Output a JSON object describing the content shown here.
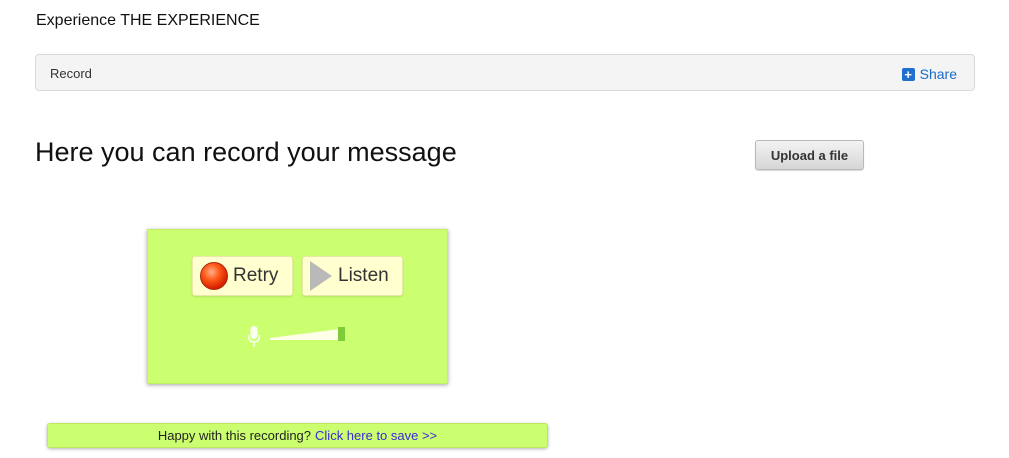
{
  "site": {
    "title": "Experience THE EXPERIENCE"
  },
  "nav": {
    "label": "Record",
    "share_label": "Share",
    "share_icon": "plus-square-icon"
  },
  "main": {
    "headline": "Here you can record your message",
    "upload_label": "Upload a file"
  },
  "recorder": {
    "retry_label": "Retry",
    "listen_label": "Listen",
    "retry_icon": "record-dot-icon",
    "listen_icon": "play-icon",
    "mic_icon": "microphone-icon",
    "input_level": 1.0,
    "background_color": "#ccff70",
    "button_color": "#ffffd0"
  },
  "save_bar": {
    "prompt": "Happy with this recording?",
    "link_label": "Click here to save >>",
    "link_color": "#3b2ad8"
  }
}
